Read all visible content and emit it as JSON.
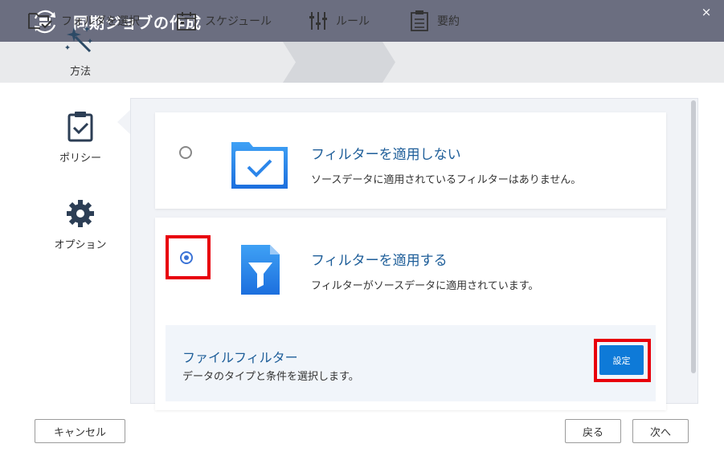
{
  "window": {
    "title": "同期ジョブの作成",
    "close_icon": "×"
  },
  "steps": [
    {
      "label": "フォルダを選択",
      "icon": "folder-check-icon"
    },
    {
      "label": "スケジュール",
      "icon": "calendar-icon"
    },
    {
      "label": "ルール",
      "icon": "sliders-icon",
      "active": true
    },
    {
      "label": "要約",
      "icon": "clipboard-list-icon"
    }
  ],
  "sidebar": {
    "items": [
      {
        "label": "方法",
        "icon": "magic-wand-icon",
        "active": true
      },
      {
        "label": "ポリシー",
        "icon": "clipboard-check-icon"
      },
      {
        "label": "オプション",
        "icon": "gear-icon"
      }
    ]
  },
  "options": [
    {
      "title": "フィルターを適用しない",
      "description": "ソースデータに適用されているフィルターはありません。",
      "selected": false,
      "icon": "folder-check-icon"
    },
    {
      "title": "フィルターを適用する",
      "description": "フィルターがソースデータに適用されています。",
      "selected": true,
      "icon": "funnel-icon"
    }
  ],
  "file_filter": {
    "title": "ファイルフィルター",
    "description": "データのタイプと条件を選択します。",
    "button_label": "設定"
  },
  "footer": {
    "cancel_label": "キャンセル",
    "back_label": "戻る",
    "next_label": "次へ"
  },
  "colors": {
    "titlebar": "#6b6e80",
    "accent": "#0e7ad8",
    "link_text": "#1e5e99",
    "highlight": "#e8000c"
  }
}
